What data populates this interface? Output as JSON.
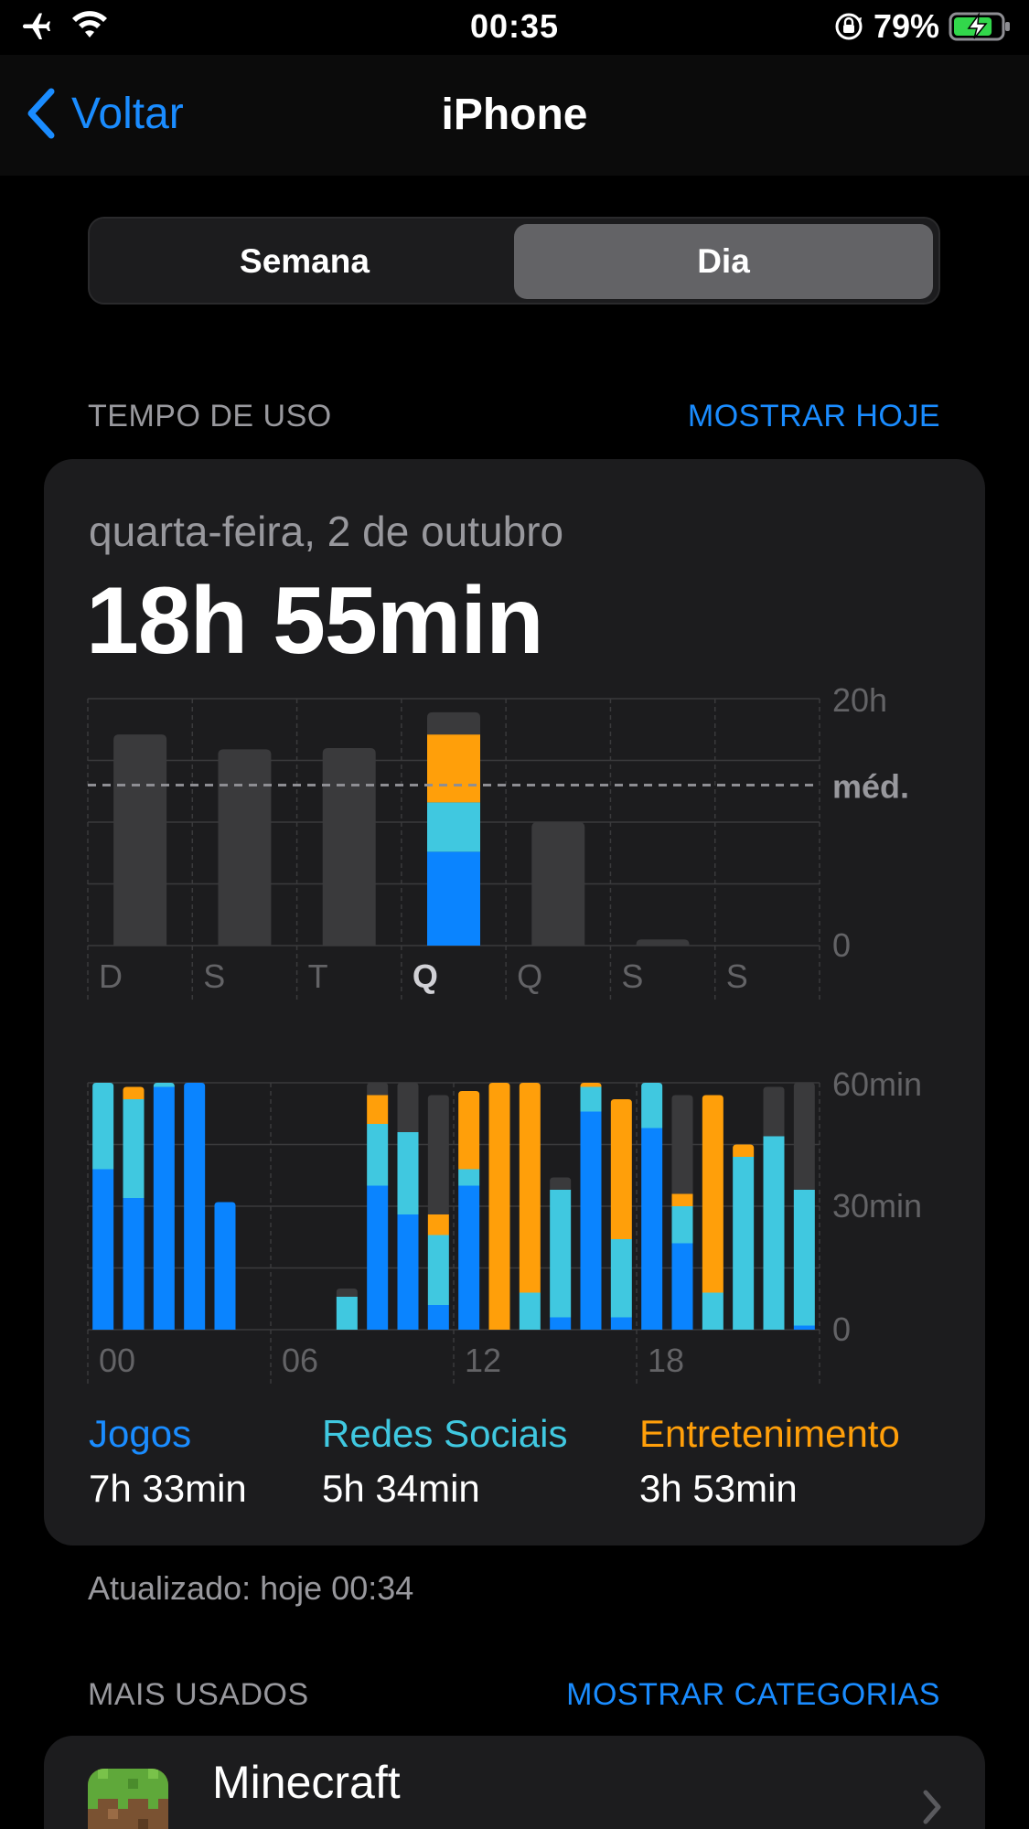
{
  "status_bar": {
    "time": "00:35",
    "battery_percent": "79%",
    "battery_level": 0.79,
    "icons": [
      "airplane-icon",
      "wifi-icon",
      "rotation-lock-icon",
      "battery-charging-icon"
    ]
  },
  "nav": {
    "back_label": "Voltar",
    "title": "iPhone"
  },
  "segmented": {
    "options": [
      "Semana",
      "Dia"
    ],
    "selected": "Dia"
  },
  "usage_section": {
    "header": "TEMPO DE USO",
    "action": "MOSTRAR HOJE"
  },
  "summary": {
    "date": "quarta-feira, 2 de outubro",
    "total": "18h 55min"
  },
  "chart_data": [
    {
      "type": "bar",
      "title": "",
      "categories": [
        "D",
        "S",
        "T",
        "Q",
        "Q",
        "S",
        "S"
      ],
      "highlighted_category_index": 3,
      "y_unit": "h",
      "ylim": [
        0,
        20
      ],
      "y_ticks": [
        "20h",
        "0"
      ],
      "average_label": "méd.",
      "average_value": 13,
      "series": [
        {
          "name": "Jogos",
          "color": "#0a84ff",
          "values": [
            0,
            0,
            0,
            7.6,
            0,
            0,
            0
          ]
        },
        {
          "name": "Redes Sociais",
          "color": "#40c8e0",
          "values": [
            0,
            0,
            0,
            4.0,
            0,
            0,
            0
          ]
        },
        {
          "name": "Entretenimento",
          "color": "#ff9f0a",
          "values": [
            0,
            0,
            0,
            5.5,
            0,
            0,
            0
          ]
        },
        {
          "name": "",
          "color": "#3a3a3c",
          "values": [
            17.1,
            15.9,
            16.0,
            1.8,
            10.0,
            0.5,
            0
          ]
        }
      ],
      "grid": true
    },
    {
      "type": "bar",
      "title": "",
      "x_tick_labels": [
        "00",
        "06",
        "12",
        "18"
      ],
      "hours": [
        0,
        1,
        2,
        3,
        4,
        5,
        6,
        7,
        8,
        9,
        10,
        11,
        12,
        13,
        14,
        15,
        16,
        17,
        18,
        19,
        20,
        21,
        22,
        23
      ],
      "y_unit": "min",
      "ylim": [
        0,
        60
      ],
      "y_ticks": [
        "60min",
        "30min",
        "0"
      ],
      "series": [
        {
          "name": "Jogos",
          "color": "#0a84ff",
          "values": [
            39,
            32,
            59,
            60,
            31,
            0,
            0,
            0,
            0,
            35,
            28,
            6,
            35,
            0,
            0,
            3,
            53,
            3,
            49,
            21,
            0,
            0,
            0,
            1
          ]
        },
        {
          "name": "Redes Sociais",
          "color": "#40c8e0",
          "values": [
            21,
            24,
            1,
            0,
            0,
            0,
            0,
            0,
            8,
            15,
            20,
            17,
            4,
            0,
            9,
            31,
            6,
            19,
            11,
            9,
            9,
            42,
            47,
            33
          ]
        },
        {
          "name": "Entretenimento",
          "color": "#ff9f0a",
          "values": [
            0,
            3,
            0,
            0,
            0,
            0,
            0,
            0,
            0,
            7,
            0,
            5,
            19,
            60,
            51,
            0,
            1,
            34,
            0,
            3,
            48,
            3,
            0,
            0
          ]
        },
        {
          "name": "",
          "color": "#3a3a3c",
          "values": [
            0,
            0,
            0,
            0,
            0,
            0,
            0,
            0,
            2,
            3,
            12,
            29,
            0,
            0,
            0,
            3,
            0,
            0,
            0,
            24,
            0,
            0,
            12,
            26
          ]
        }
      ],
      "grid": true
    }
  ],
  "legend": [
    {
      "label": "Jogos",
      "value": "7h 33min",
      "color": "#1a8cff"
    },
    {
      "label": "Redes Sociais",
      "value": "5h 34min",
      "color": "#40c8e0"
    },
    {
      "label": "Entretenimento",
      "value": "3h 53min",
      "color": "#ff9f0a"
    }
  ],
  "updated": "Atualizado: hoje 00:34",
  "most_used": {
    "header": "MAIS USADOS",
    "action": "MOSTRAR CATEGORIAS",
    "apps": [
      {
        "name": "Minecraft",
        "icon": "minecraft-icon"
      }
    ]
  }
}
